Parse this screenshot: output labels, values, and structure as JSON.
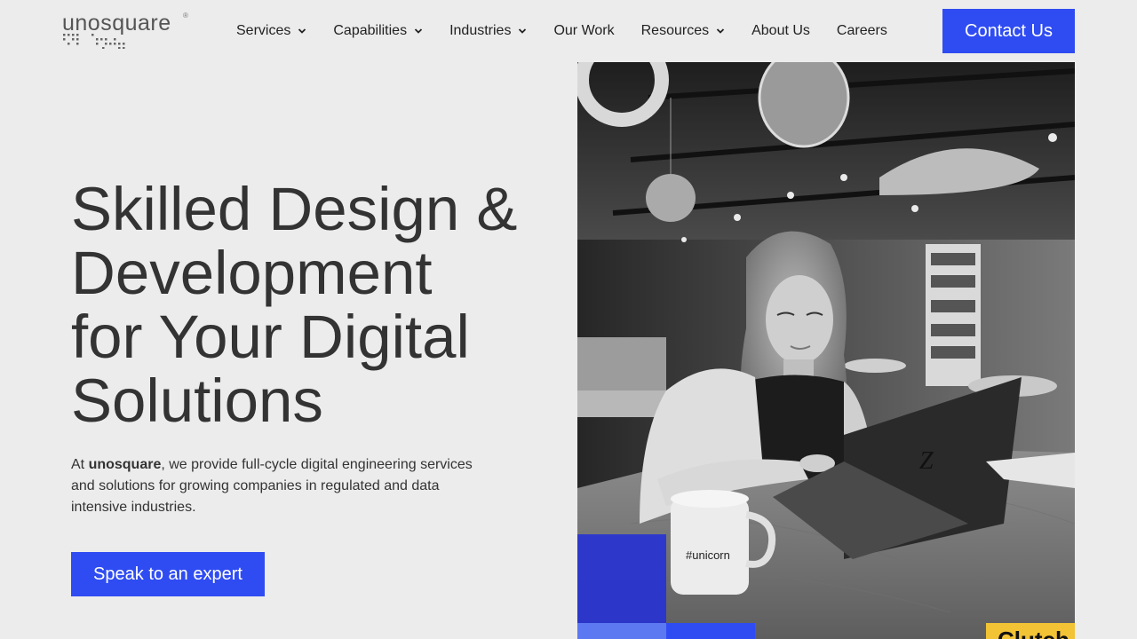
{
  "brand": {
    "logo_text": "unosquare",
    "logo_reg": "®",
    "accent_color": "#2f4cf2"
  },
  "nav": {
    "items": [
      {
        "label": "Services",
        "has_dropdown": true
      },
      {
        "label": "Capabilities",
        "has_dropdown": true
      },
      {
        "label": "Industries",
        "has_dropdown": true
      },
      {
        "label": "Our Work",
        "has_dropdown": false
      },
      {
        "label": "Resources",
        "has_dropdown": true
      },
      {
        "label": "About Us",
        "has_dropdown": false
      },
      {
        "label": "Careers",
        "has_dropdown": false
      }
    ],
    "contact_label": "Contact Us"
  },
  "hero": {
    "title_lines": [
      "Skilled Design &",
      "Development",
      "for Your Digital",
      "Solutions"
    ],
    "desc_prefix": "At ",
    "desc_brand": "unosquare",
    "desc_rest": ", we provide full-cycle digital engineering services and solutions for growing companies in regulated and data intensive industries.",
    "cta_label": "Speak to an expert"
  },
  "photo": {
    "mug_text": "#unicorn",
    "badge_text": "Clutch",
    "badge_color": "#f2c335"
  }
}
